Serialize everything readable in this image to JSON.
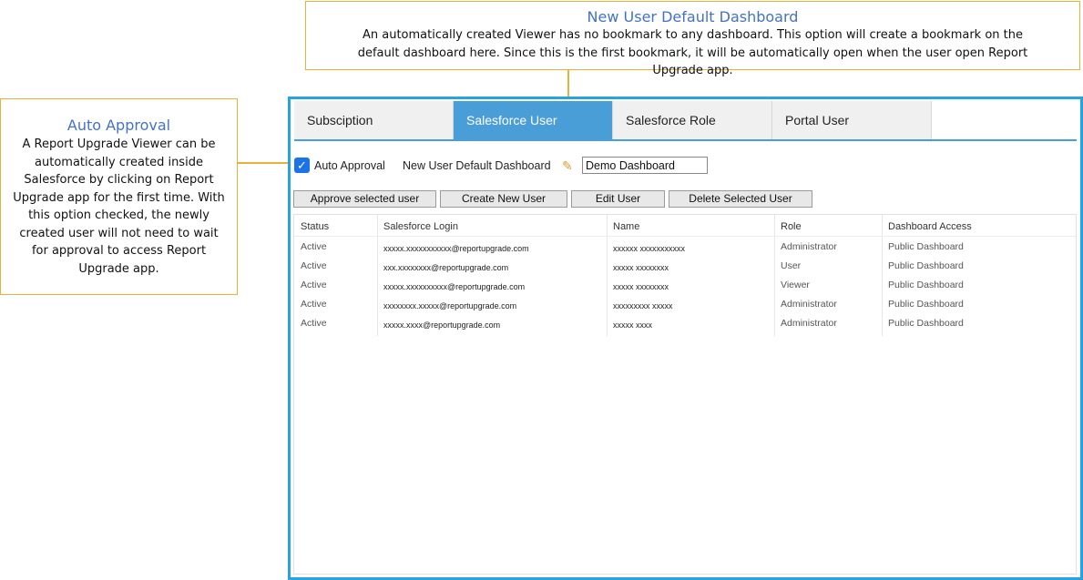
{
  "callouts": {
    "top": {
      "title": "New User Default Dashboard",
      "body": "An automatically created Viewer has no bookmark  to any dashboard. This option will create a bookmark  on the default dashboard here. Since this is the first bookmark,  it will be automatically open  when the user open Report Upgrade app."
    },
    "left": {
      "title": "Auto Approval",
      "body": "A Report Upgrade Viewer can be automatically created inside Salesforce by clicking on Report Upgrade app for the first time. With this option  checked, the newly created user will not need to wait for approval to access Report Upgrade app."
    }
  },
  "tabs": [
    "Subsciption",
    "Salesforce User",
    "Salesforce Role",
    "Portal User"
  ],
  "active_tab": "Salesforce User",
  "options": {
    "auto_approval_label": "Auto Approval",
    "auto_approval_checked": true,
    "checkmark": "✓",
    "default_dashboard_label": "New User Default Dashboard",
    "pencil_icon": "✎",
    "default_dashboard_value": "Demo Dashboard"
  },
  "buttons": {
    "approve": "Approve selected user",
    "create": "Create New User",
    "edit": "Edit User",
    "delete": "Delete Selected User"
  },
  "table": {
    "columns": [
      "Status",
      "Salesforce Login",
      "Name",
      "Role",
      "Dashboard Access"
    ],
    "rows": [
      [
        "Active",
        "xxxxx.xxxxxxxxxxx@reportupgrade.com",
        "xxxxxx xxxxxxxxxxx",
        "Administrator",
        "Public Dashboard"
      ],
      [
        "Active",
        "xxx.xxxxxxxx@reportupgrade.com",
        "xxxxx xxxxxxxx",
        "User",
        "Public Dashboard"
      ],
      [
        "Active",
        "xxxxx.xxxxxxxxxx@reportupgrade.com",
        "xxxxx xxxxxxxx",
        "Viewer",
        "Public Dashboard"
      ],
      [
        "Active",
        "xxxxxxxx.xxxxx@reportupgrade.com",
        "xxxxxxxxx xxxxx",
        "Administrator",
        "Public Dashboard"
      ],
      [
        "Active",
        "xxxxx.xxxx@reportupgrade.com",
        "xxxxx xxxx",
        "Administrator",
        "Public Dashboard"
      ]
    ]
  },
  "colors": {
    "accent": "#4a9ed8",
    "frame": "#29a3e0",
    "callout_border": "#e8b23a",
    "callout_title": "#4472c4"
  }
}
